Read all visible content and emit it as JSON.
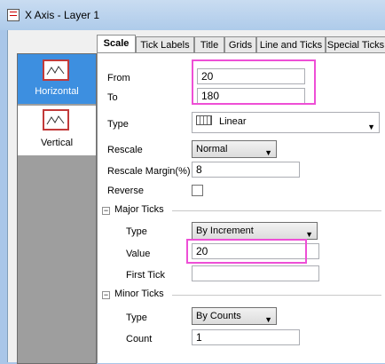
{
  "window": {
    "title": "X Axis - Layer 1"
  },
  "nav": {
    "items": [
      {
        "label": "Horizontal",
        "selected": true
      },
      {
        "label": "Vertical",
        "selected": false
      }
    ]
  },
  "tabs": [
    "Scale",
    "Tick Labels",
    "Title",
    "Grids",
    "Line and Ticks",
    "Special Ticks"
  ],
  "active_tab": "Scale",
  "scale": {
    "from_label": "From",
    "from_value": "20",
    "to_label": "To",
    "to_value": "180",
    "type_label": "Type",
    "type_value": "Linear",
    "rescale_label": "Rescale",
    "rescale_value": "Normal",
    "rescale_margin_label": "Rescale Margin(%)",
    "rescale_margin_value": "8",
    "reverse_label": "Reverse",
    "reverse_checked": false
  },
  "major_ticks": {
    "header": "Major Ticks",
    "type_label": "Type",
    "type_value": "By Increment",
    "value_label": "Value",
    "value_value": "20",
    "first_tick_label": "First Tick",
    "first_tick_value": ""
  },
  "minor_ticks": {
    "header": "Minor Ticks",
    "type_label": "Type",
    "type_value": "By Counts",
    "count_label": "Count",
    "count_value": "1"
  },
  "colors": {
    "highlight": "#ee4fd6",
    "nav_selected": "#3d8fe0"
  }
}
